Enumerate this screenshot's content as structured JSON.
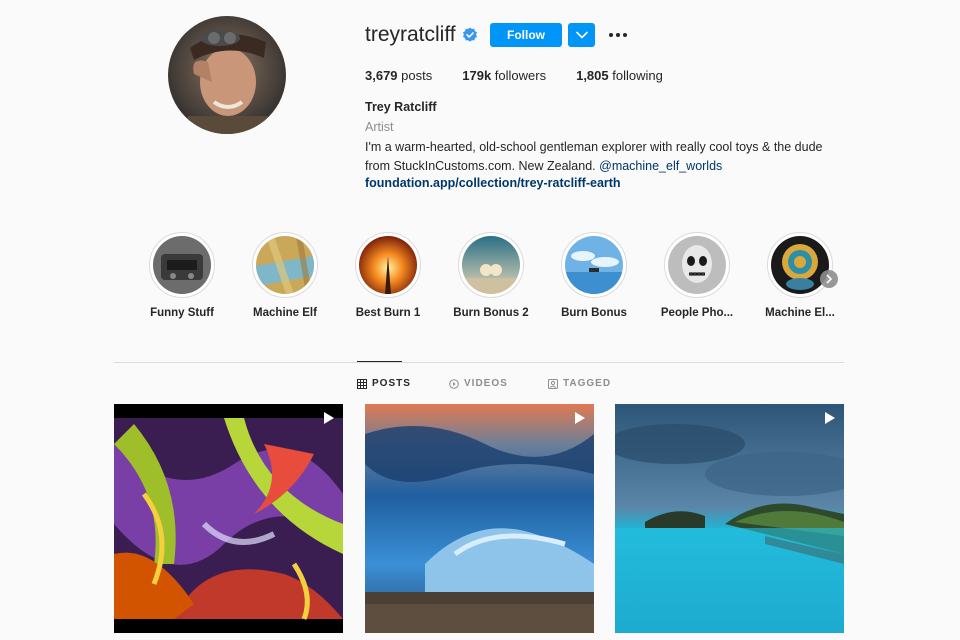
{
  "profile": {
    "username": "treyratcliff",
    "verified": true,
    "follow_label": "Follow",
    "stats": {
      "posts": "3,679",
      "posts_label": "posts",
      "followers": "179k",
      "followers_label": "followers",
      "following": "1,805",
      "following_label": "following"
    },
    "full_name": "Trey Ratcliff",
    "category": "Artist",
    "bio_line1": "I'm a warm-hearted, old-school gentleman explorer with really cool toys & the dude",
    "bio_line2": "from StuckInCustoms.com. New Zealand.",
    "bio_mention": "@machine_elf_worlds",
    "link": "foundation.app/collection/trey-ratcliff-earth"
  },
  "highlights": [
    {
      "label": "Funny Stuff"
    },
    {
      "label": "Machine Elf"
    },
    {
      "label": "Best Burn 1"
    },
    {
      "label": "Burn Bonus 2"
    },
    {
      "label": "Burn Bonus"
    },
    {
      "label": "People Pho..."
    },
    {
      "label": "Machine El..."
    }
  ],
  "tabs": [
    {
      "label": "POSTS",
      "icon": "grid-icon",
      "active": true
    },
    {
      "label": "VIDEOS",
      "icon": "video-icon",
      "active": false
    },
    {
      "label": "TAGGED",
      "icon": "tag-icon",
      "active": false
    }
  ],
  "posts": [
    {
      "type": "reel",
      "icon": "reel-icon"
    },
    {
      "type": "reel",
      "icon": "reel-icon"
    },
    {
      "type": "reel",
      "icon": "reel-icon"
    }
  ],
  "colors": {
    "accent": "#0095f6",
    "link": "#00376b",
    "muted": "#8e8e8e",
    "background": "#fafafa"
  }
}
